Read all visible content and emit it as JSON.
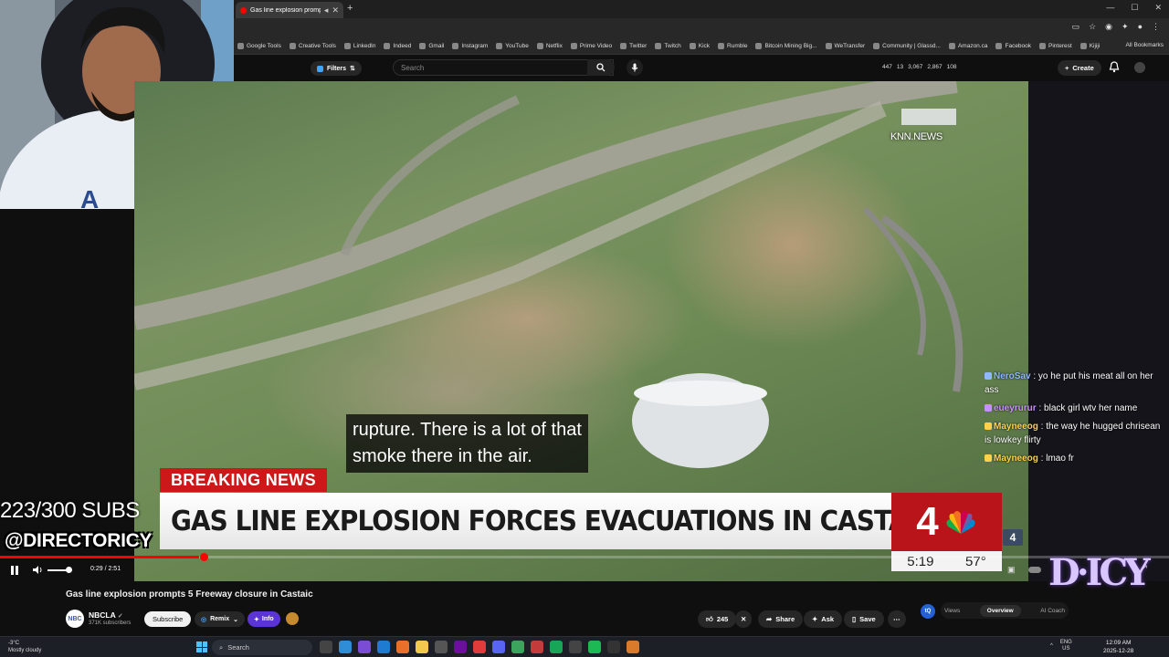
{
  "browser": {
    "tab_title": "Gas line explosion prompt",
    "bookmarks": [
      "Google Tools",
      "Creative Tools",
      "LinkedIn",
      "Indeed",
      "Gmail",
      "Instagram",
      "YouTube",
      "Netflix",
      "Prime Video",
      "Twitter",
      "Twitch",
      "Kick",
      "Rumble",
      "Bitcoin Mining Big...",
      "WeTransfer",
      "Community | Glassd...",
      "Amazon.ca",
      "Facebook",
      "Pinterest",
      "Kijiji"
    ],
    "all_bookmarks": "All Bookmarks"
  },
  "youtube": {
    "filters_label": "Filters",
    "search_placeholder": "Search",
    "stats": [
      "447",
      "13",
      "3,067",
      "2,867",
      "108"
    ],
    "create_label": "Create"
  },
  "video": {
    "watermark": "KNN.NEWS",
    "subtitle_line1": "rupture. There is a lot of that",
    "subtitle_line2": "smoke there in the air.",
    "breaking": "BREAKING NEWS",
    "headline": "GAS LINE EXPLOSION FORCES EVACUATIONS IN CASTAIC",
    "channel_number": "4",
    "clock_time": "5:19",
    "temperature": "57°",
    "bug": "4"
  },
  "player": {
    "time": "0:29 / 2:51",
    "progress": 0.17
  },
  "overlay": {
    "subs_count": "223/300 SUBS",
    "handle": "@DIRECTORICY"
  },
  "chat": [
    {
      "user": "NeroSav",
      "text": "yo he put his meat all on her ass",
      "color": "#8fb8ff"
    },
    {
      "user": "eueyrurur",
      "text": "black girl wtv her name",
      "color": "#c98fff"
    },
    {
      "user": "Mayneeog",
      "text": "the way he hugged chrisean is lowkey flirty",
      "color": "#ffd24a"
    },
    {
      "user": "Mayneeog",
      "text": "lmao fr",
      "color": "#ffd24a"
    }
  ],
  "below": {
    "title": "Gas line explosion prompts 5 Freeway closure in Castaic",
    "channel_name": "NBCLA",
    "channel_subs": "371K subscribers",
    "subscribe": "Subscribe",
    "remix": "Remix",
    "info": "Info",
    "likes": "245",
    "share": "Share",
    "ask": "Ask",
    "save": "Save",
    "tab_views": "Views",
    "tab_overview": "Overview",
    "tab_ai_coach": "AI Coach"
  },
  "taskbar": {
    "weather_temp": "-3°C",
    "weather_desc": "Mostly cloudy",
    "search": "Search",
    "lang1": "ENG",
    "lang2": "US",
    "time": "12:09 AM",
    "date": "2025-12-28"
  },
  "colors": {
    "breaking_red": "#cc1818",
    "progress_red": "#ff0000",
    "info_purple": "#5b34d6"
  }
}
